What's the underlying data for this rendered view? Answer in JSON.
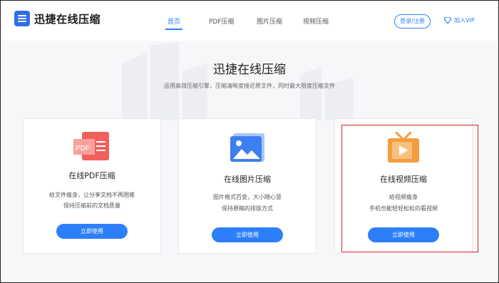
{
  "header": {
    "logo_text": "迅捷在线压缩",
    "nav": [
      {
        "label": "首页",
        "active": true
      },
      {
        "label": "PDF压缩",
        "active": false
      },
      {
        "label": "图片压缩",
        "active": false
      },
      {
        "label": "视频压缩",
        "active": false
      }
    ],
    "login_label": "登录/注册",
    "vip_label": "加入VIP"
  },
  "hero": {
    "title": "迅捷在线压缩",
    "subtitle": "运用高效压缩引擎，压缩清晰度接近原文件，同时最大限度压缩文件"
  },
  "cards": [
    {
      "title": "在线PDF压缩",
      "desc_line1": "给文件瘦身，让分享文档不再困难",
      "desc_line2": "保持压缩前的文档质量",
      "button": "立即使用",
      "icon": "pdf-icon",
      "icon_text": "PDF"
    },
    {
      "title": "在线图片压缩",
      "desc_line1": "图片格式百变，大小随心意",
      "desc_line2": "保持原稿的排版方式",
      "button": "立即使用",
      "icon": "image-icon"
    },
    {
      "title": "在线视频压缩",
      "desc_line1": "给视频瘦身",
      "desc_line2": "手机也能轻轻松松的看视频",
      "button": "立即使用",
      "icon": "video-icon"
    }
  ],
  "colors": {
    "accent": "#2d7ff9",
    "highlight": "#e02222",
    "pdf": "#f25f5c",
    "video": "#f59c3c"
  }
}
